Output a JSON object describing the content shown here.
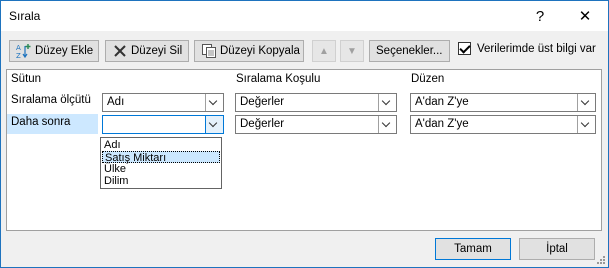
{
  "window": {
    "title": "Sırala",
    "help_glyph": "?",
    "close_glyph": "✕"
  },
  "toolbar": {
    "add_level": "Düzey Ekle",
    "delete_level": "Düzeyi Sil",
    "copy_level": "Düzeyi Kopyala",
    "options": "Seçenekler...",
    "header_checkbox_label": "Verilerimde üst bilgi var",
    "header_checkbox_checked": true
  },
  "grid": {
    "headers": {
      "column": "Sütun",
      "sort_on": "Sıralama Koşulu",
      "order": "Düzen"
    },
    "rows": [
      {
        "label": "Sıralama ölçütü",
        "column_value": "Adı",
        "sort_on": "Değerler",
        "order": "A'dan Z'ye"
      },
      {
        "label": "Daha sonra",
        "column_value": "",
        "sort_on": "Değerler",
        "order": "A'dan Z'ye"
      }
    ]
  },
  "dropdown": {
    "options": [
      "Adı",
      "Satış Miktarı",
      "Ülke",
      "Dilim"
    ],
    "highlighted": "Satış Miktarı"
  },
  "footer": {
    "ok": "Tamam",
    "cancel": "İptal"
  },
  "colors": {
    "accent": "#0078d7",
    "selection": "#cde8ff",
    "border": "#1e73be"
  }
}
